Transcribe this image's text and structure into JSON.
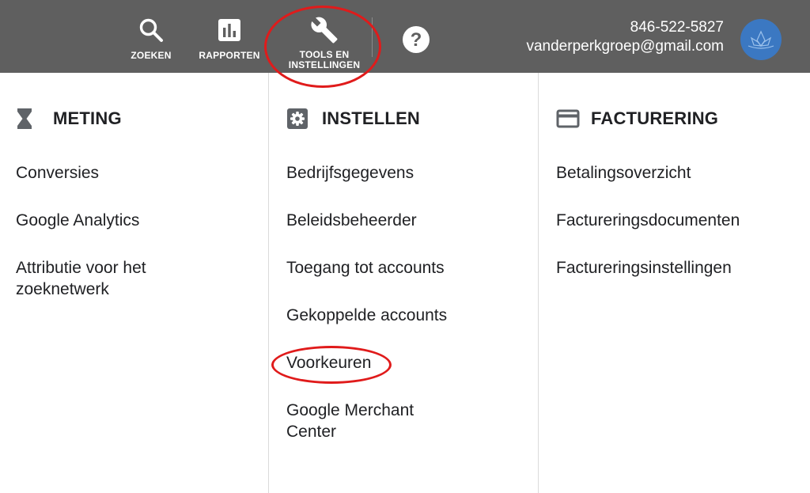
{
  "header": {
    "tools": [
      {
        "label": "ZOEKEN",
        "icon": "search-icon"
      },
      {
        "label": "RAPPORTEN",
        "icon": "bar-chart-icon"
      },
      {
        "label_line1": "TOOLS EN",
        "label_line2": "INSTELLINGEN",
        "icon": "wrench-icon"
      },
      {
        "label": "",
        "icon": "help-icon"
      }
    ],
    "account": {
      "phone": "846-522-5827",
      "email": "vanderperkgroep@gmail.com",
      "avatar_color": "#3b78c2"
    },
    "bar_color": "#5f5f5f"
  },
  "columns": [
    {
      "title": "METING",
      "icon": "hourglass-icon",
      "items": [
        "Conversies",
        "Google Analytics",
        "Attributie voor het zoeknetwerk"
      ]
    },
    {
      "title": "INSTELLEN",
      "icon": "gear-icon",
      "items": [
        "Bedrijfsgegevens",
        "Beleidsbeheerder",
        "Toegang tot accounts",
        "Gekoppelde accounts",
        "Voorkeuren",
        "Google Merchant Center"
      ]
    },
    {
      "title": "FACTURERING",
      "icon": "credit-card-icon",
      "items": [
        "Betalingsoverzicht",
        "Factureringsdocumenten",
        "Factureringsinstellingen"
      ]
    }
  ],
  "annotation_color": "#e01b1b"
}
